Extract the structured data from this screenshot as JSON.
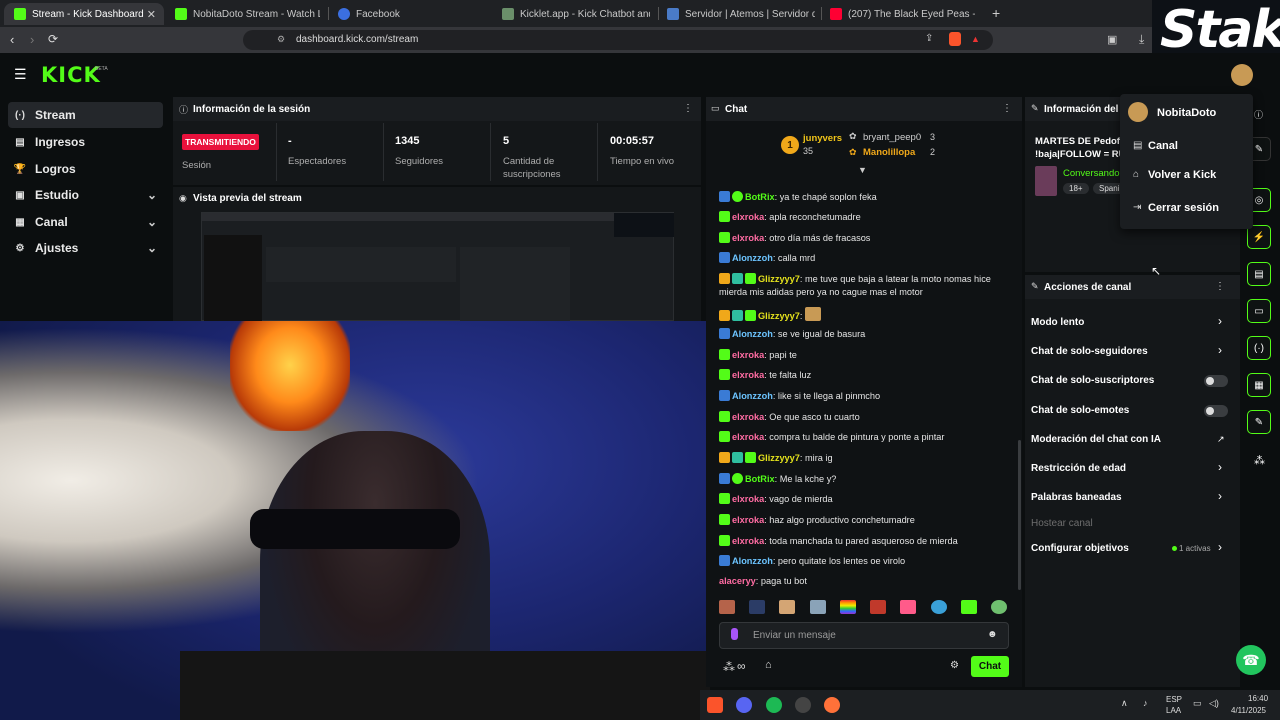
{
  "browser": {
    "tabs": [
      {
        "title": "Stream - Kick Dashboard",
        "active": true
      },
      {
        "title": "NobitaDoto Stream - Watch Live"
      },
      {
        "title": "Facebook"
      },
      {
        "title": "Kicklet.app - Kick Chatbot and Overla"
      },
      {
        "title": "Servidor | Atemos | Servidor de Mine"
      },
      {
        "title": "(207) The Black Eyed Peas - Let's"
      }
    ],
    "new_tab": "+",
    "url": "dashboard.kick.com/stream"
  },
  "overlay_logo": "Stake",
  "kick": {
    "logo": "KICK",
    "beta": "BETA"
  },
  "sidebar": {
    "items": [
      {
        "label": "Stream",
        "icon": "(·)"
      },
      {
        "label": "Ingresos",
        "icon": "▤"
      },
      {
        "label": "Logros",
        "icon": "🏆"
      },
      {
        "label": "Estudio",
        "icon": "▣"
      },
      {
        "label": "Canal",
        "icon": "▦"
      },
      {
        "label": "Ajustes",
        "icon": "⚙"
      }
    ]
  },
  "session": {
    "title": "Información de la sesión",
    "badge": "TRANSMITIENDO",
    "stats": [
      {
        "value": "",
        "label": "Sesión"
      },
      {
        "value": "-",
        "label": "Espectadores"
      },
      {
        "value": "1345",
        "label": "Seguidores"
      },
      {
        "value": "5",
        "label": "Cantidad de suscripciones"
      },
      {
        "value": "00:05:57",
        "label": "Tiempo en vivo"
      }
    ]
  },
  "preview": {
    "title": "Vista previa del stream"
  },
  "chat": {
    "title": "Chat",
    "leaderboard": {
      "rank": "1",
      "top_user": "junyvers",
      "top_count": "35",
      "others": [
        {
          "name": "bryant_peep0",
          "count": "3"
        },
        {
          "name": "Manolillopa",
          "count": "2"
        }
      ]
    },
    "messages": [
      {
        "user": "BotRix",
        "text": ": ya te chapé soplon feka",
        "color": "#6cc4ff"
      },
      {
        "user": "elxroka",
        "text": ": apla reconchetumadre",
        "color": "#ff6ca3"
      },
      {
        "user": "elxroka",
        "text": ": otro día más de fracasos",
        "color": "#ff6ca3"
      },
      {
        "user": "Alonzzoh",
        "text": ": calla mrd",
        "color": "#6cc4ff"
      },
      {
        "user": "Glizzyyy7",
        "text": ": me tuve que baja a latear la moto nomas hice",
        "color": "#e4e21d"
      },
      {
        "user": "",
        "text": "mierda mis adidas pero ya no cague mas el motor",
        "color": "#e4e21d"
      },
      {
        "user": "Glizzyyy7",
        "text": ":",
        "color": "#e4e21d"
      },
      {
        "user": "Alonzzoh",
        "text": ": se ve igual de basura",
        "color": "#6cc4ff"
      },
      {
        "user": "elxroka",
        "text": ": papi te",
        "color": "#ff6ca3"
      },
      {
        "user": "elxroka",
        "text": ": te falta luz",
        "color": "#ff6ca3"
      },
      {
        "user": "Alonzzoh",
        "text": ": like si te llega al pinmcho",
        "color": "#6cc4ff"
      },
      {
        "user": "elxroka",
        "text": ": Oe que asco tu cuarto",
        "color": "#ff6ca3"
      },
      {
        "user": "elxroka",
        "text": ": compra tu balde de pintura y ponte a pintar",
        "color": "#ff6ca3"
      },
      {
        "user": "Glizzyyy7",
        "text": ": mira ig",
        "color": "#e4e21d"
      },
      {
        "user": "BotRix",
        "text": ": Me la kche y?",
        "color": "#6cc4ff"
      },
      {
        "user": "elxroka",
        "text": ": vago de mierda",
        "color": "#ff6ca3"
      },
      {
        "user": "elxroka",
        "text": ": haz algo productivo conchetumadre",
        "color": "#ff6ca3"
      },
      {
        "user": "elxroka",
        "text": ": toda manchada tu pared asqueroso de mierda",
        "color": "#ff6ca3"
      },
      {
        "user": "Alonzzoh",
        "text": ": pero quitate los lentes oe virolo",
        "color": "#6cc4ff"
      },
      {
        "user": "alaceryy",
        "text": ": paga tu bot",
        "color": "#ff6ca3"
      }
    ],
    "input_placeholder": "Enviar un mensaje",
    "send_label": "Chat"
  },
  "stream_info": {
    "title": "Información del s",
    "stream_title_line1": "MARTES DE Pedofi",
    "stream_title_line2": "!baja|FOLLOW = RU",
    "category": "Conversando",
    "tags": [
      "18+",
      "Spani"
    ]
  },
  "actions": {
    "title": "Acciones de canal",
    "items": [
      {
        "label": "Modo lento",
        "kind": "arrow"
      },
      {
        "label": "Chat de solo-seguidores",
        "kind": "arrow"
      },
      {
        "label": "Chat de solo-suscriptores",
        "kind": "toggle"
      },
      {
        "label": "Chat de solo-emotes",
        "kind": "toggle"
      },
      {
        "label": "Moderación del chat con IA",
        "kind": "external"
      },
      {
        "label": "Restricción de edad",
        "kind": "arrow"
      },
      {
        "label": "Palabras baneadas",
        "kind": "arrow"
      },
      {
        "label": "Hostear canal",
        "kind": "disabled"
      },
      {
        "label": "Configurar objetivos",
        "kind": "arrow",
        "note": "1 activas"
      }
    ]
  },
  "user_menu": {
    "username": "NobitaDoto",
    "items": [
      "Canal",
      "Volver a Kick",
      "Cerrar sesión"
    ]
  },
  "taskbar": {
    "lang": "ESP",
    "lang2": "LAA",
    "time": "16:40",
    "date": "4/11/2025"
  },
  "colors": {
    "kick_green": "#53fc18",
    "live_red": "#e9113c"
  }
}
